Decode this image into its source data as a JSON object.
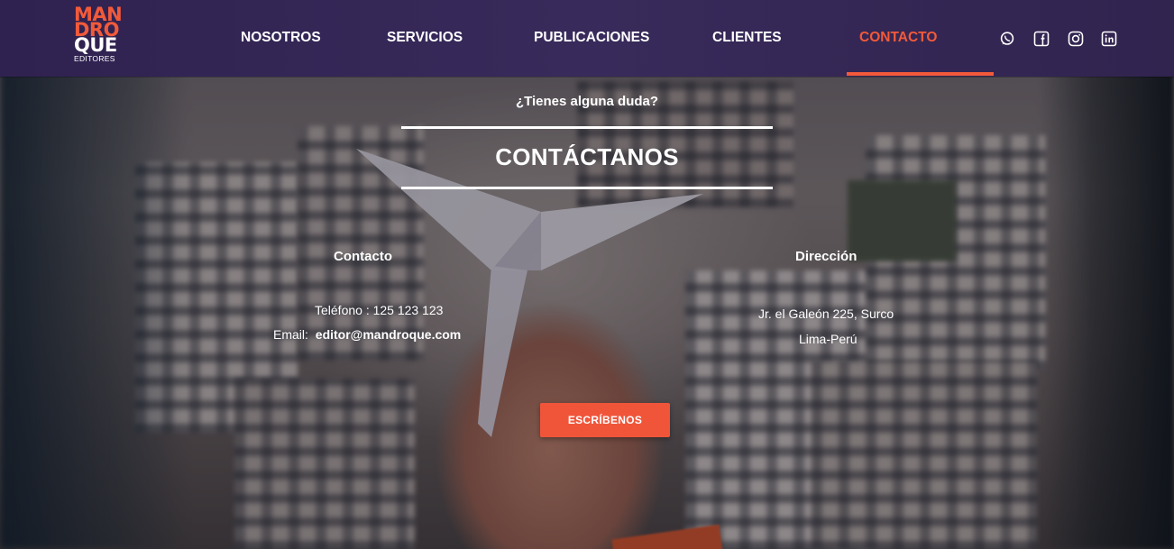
{
  "brand": {
    "logo_line1": "MAN",
    "logo_line2": "DRO",
    "logo_line3": "QUE",
    "logo_sub": "EDITORES",
    "accent_color": "#f25a3a",
    "header_color": "#352755"
  },
  "nav": {
    "items": [
      {
        "label": "NOSOTROS"
      },
      {
        "label": "SERVICIOS"
      },
      {
        "label": "PUBLICACIONES"
      },
      {
        "label": "CLIENTES"
      },
      {
        "label": "CONTACTO",
        "active": true
      }
    ]
  },
  "socials": [
    {
      "icon": "whatsapp-icon"
    },
    {
      "icon": "facebook-icon"
    },
    {
      "icon": "instagram-icon"
    },
    {
      "icon": "linkedin-icon"
    }
  ],
  "hero": {
    "question": "¿Tienes alguna duda?",
    "title": "CONTÁCTANOS"
  },
  "contact": {
    "heading": "Contacto",
    "phone": "Teléfono : 125 123 123",
    "email_label": "Email:",
    "email_value": "editor@mandroque.com"
  },
  "address": {
    "heading": "Dirección",
    "line1": "Jr. el Galeón 225, Surco",
    "line2": "Lima-Perú"
  },
  "cta": {
    "label": "ESCRÍBENOS"
  }
}
